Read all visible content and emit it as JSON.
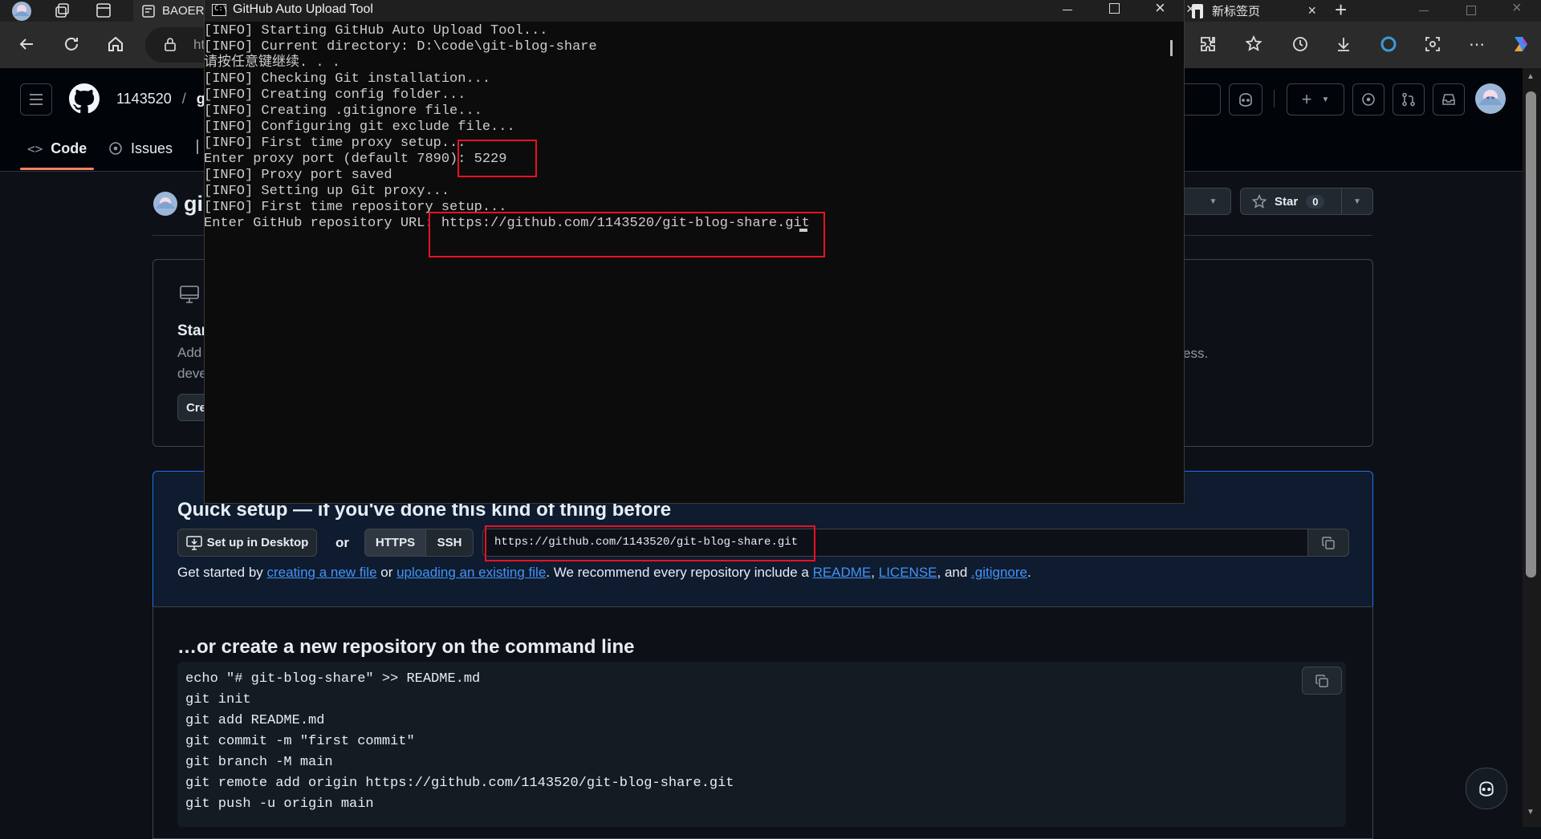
{
  "browser": {
    "tabs": [
      {
        "label": "BAOER"
      },
      {
        "label": "新标签页"
      }
    ],
    "url_partial": "ht",
    "new_tab_symbol": "+"
  },
  "console": {
    "title": "GitHub Auto Upload Tool",
    "lines": [
      "[INFO] Starting GitHub Auto Upload Tool...",
      "[INFO] Current directory: D:\\code\\git-blog-share",
      "请按任意键继续. . .",
      "[INFO] Checking Git installation...",
      "[INFO] Creating config folder...",
      "[INFO] Creating .gitignore file...",
      "[INFO] Configuring git exclude file...",
      "[INFO] First time proxy setup...",
      "Enter proxy port (default 7890): 5229",
      "[INFO] Proxy port saved",
      "[INFO] Setting up Git proxy...",
      "[INFO] First time repository setup...",
      "Enter GitHub repository URL: https://github.com/1143520/git-blog-share.git"
    ]
  },
  "github": {
    "breadcrumb_owner": "1143520",
    "breadcrumb_sep": "/",
    "breadcrumb_repo_partial": "gi",
    "repo_title_partial": "gi",
    "tabs": [
      {
        "label": "Code"
      },
      {
        "label": "Issues"
      }
    ],
    "star_label": "Star",
    "star_count": "0",
    "start_card": {
      "title_partial": "Star",
      "line1_partial": "Add",
      "line2_partial": "deve",
      "button_partial": "Cre",
      "trailing_partial": "ess."
    },
    "quick_setup": {
      "title": "Quick setup — if you've done this kind of thing before",
      "desktop_button": "Set up in Desktop",
      "or": "or",
      "https": "HTTPS",
      "ssh": "SSH",
      "url": "https://github.com/1143520/git-blog-share.git",
      "help": {
        "t1": "Get started by ",
        "l1": "creating a new file",
        "t2": " or ",
        "l2": "uploading an existing file",
        "t3": ". We recommend every repository include a ",
        "l3": "README",
        "t4": ", ",
        "l4": "LICENSE",
        "t5": ", and ",
        "l5": ".gitignore",
        "t6": "."
      }
    },
    "cmdline": {
      "title": "…or create a new repository on the command line",
      "lines": [
        "echo \"# git-blog-share\" >> README.md",
        "git init",
        "git add README.md",
        "git commit -m \"first commit\"",
        "git branch -M main",
        "git remote add origin https://github.com/1143520/git-blog-share.git",
        "git push -u origin main"
      ]
    }
  },
  "colors": {
    "highlight": "#e81123",
    "link": "#4493f8",
    "quick_setup_border": "#1f6feb"
  }
}
